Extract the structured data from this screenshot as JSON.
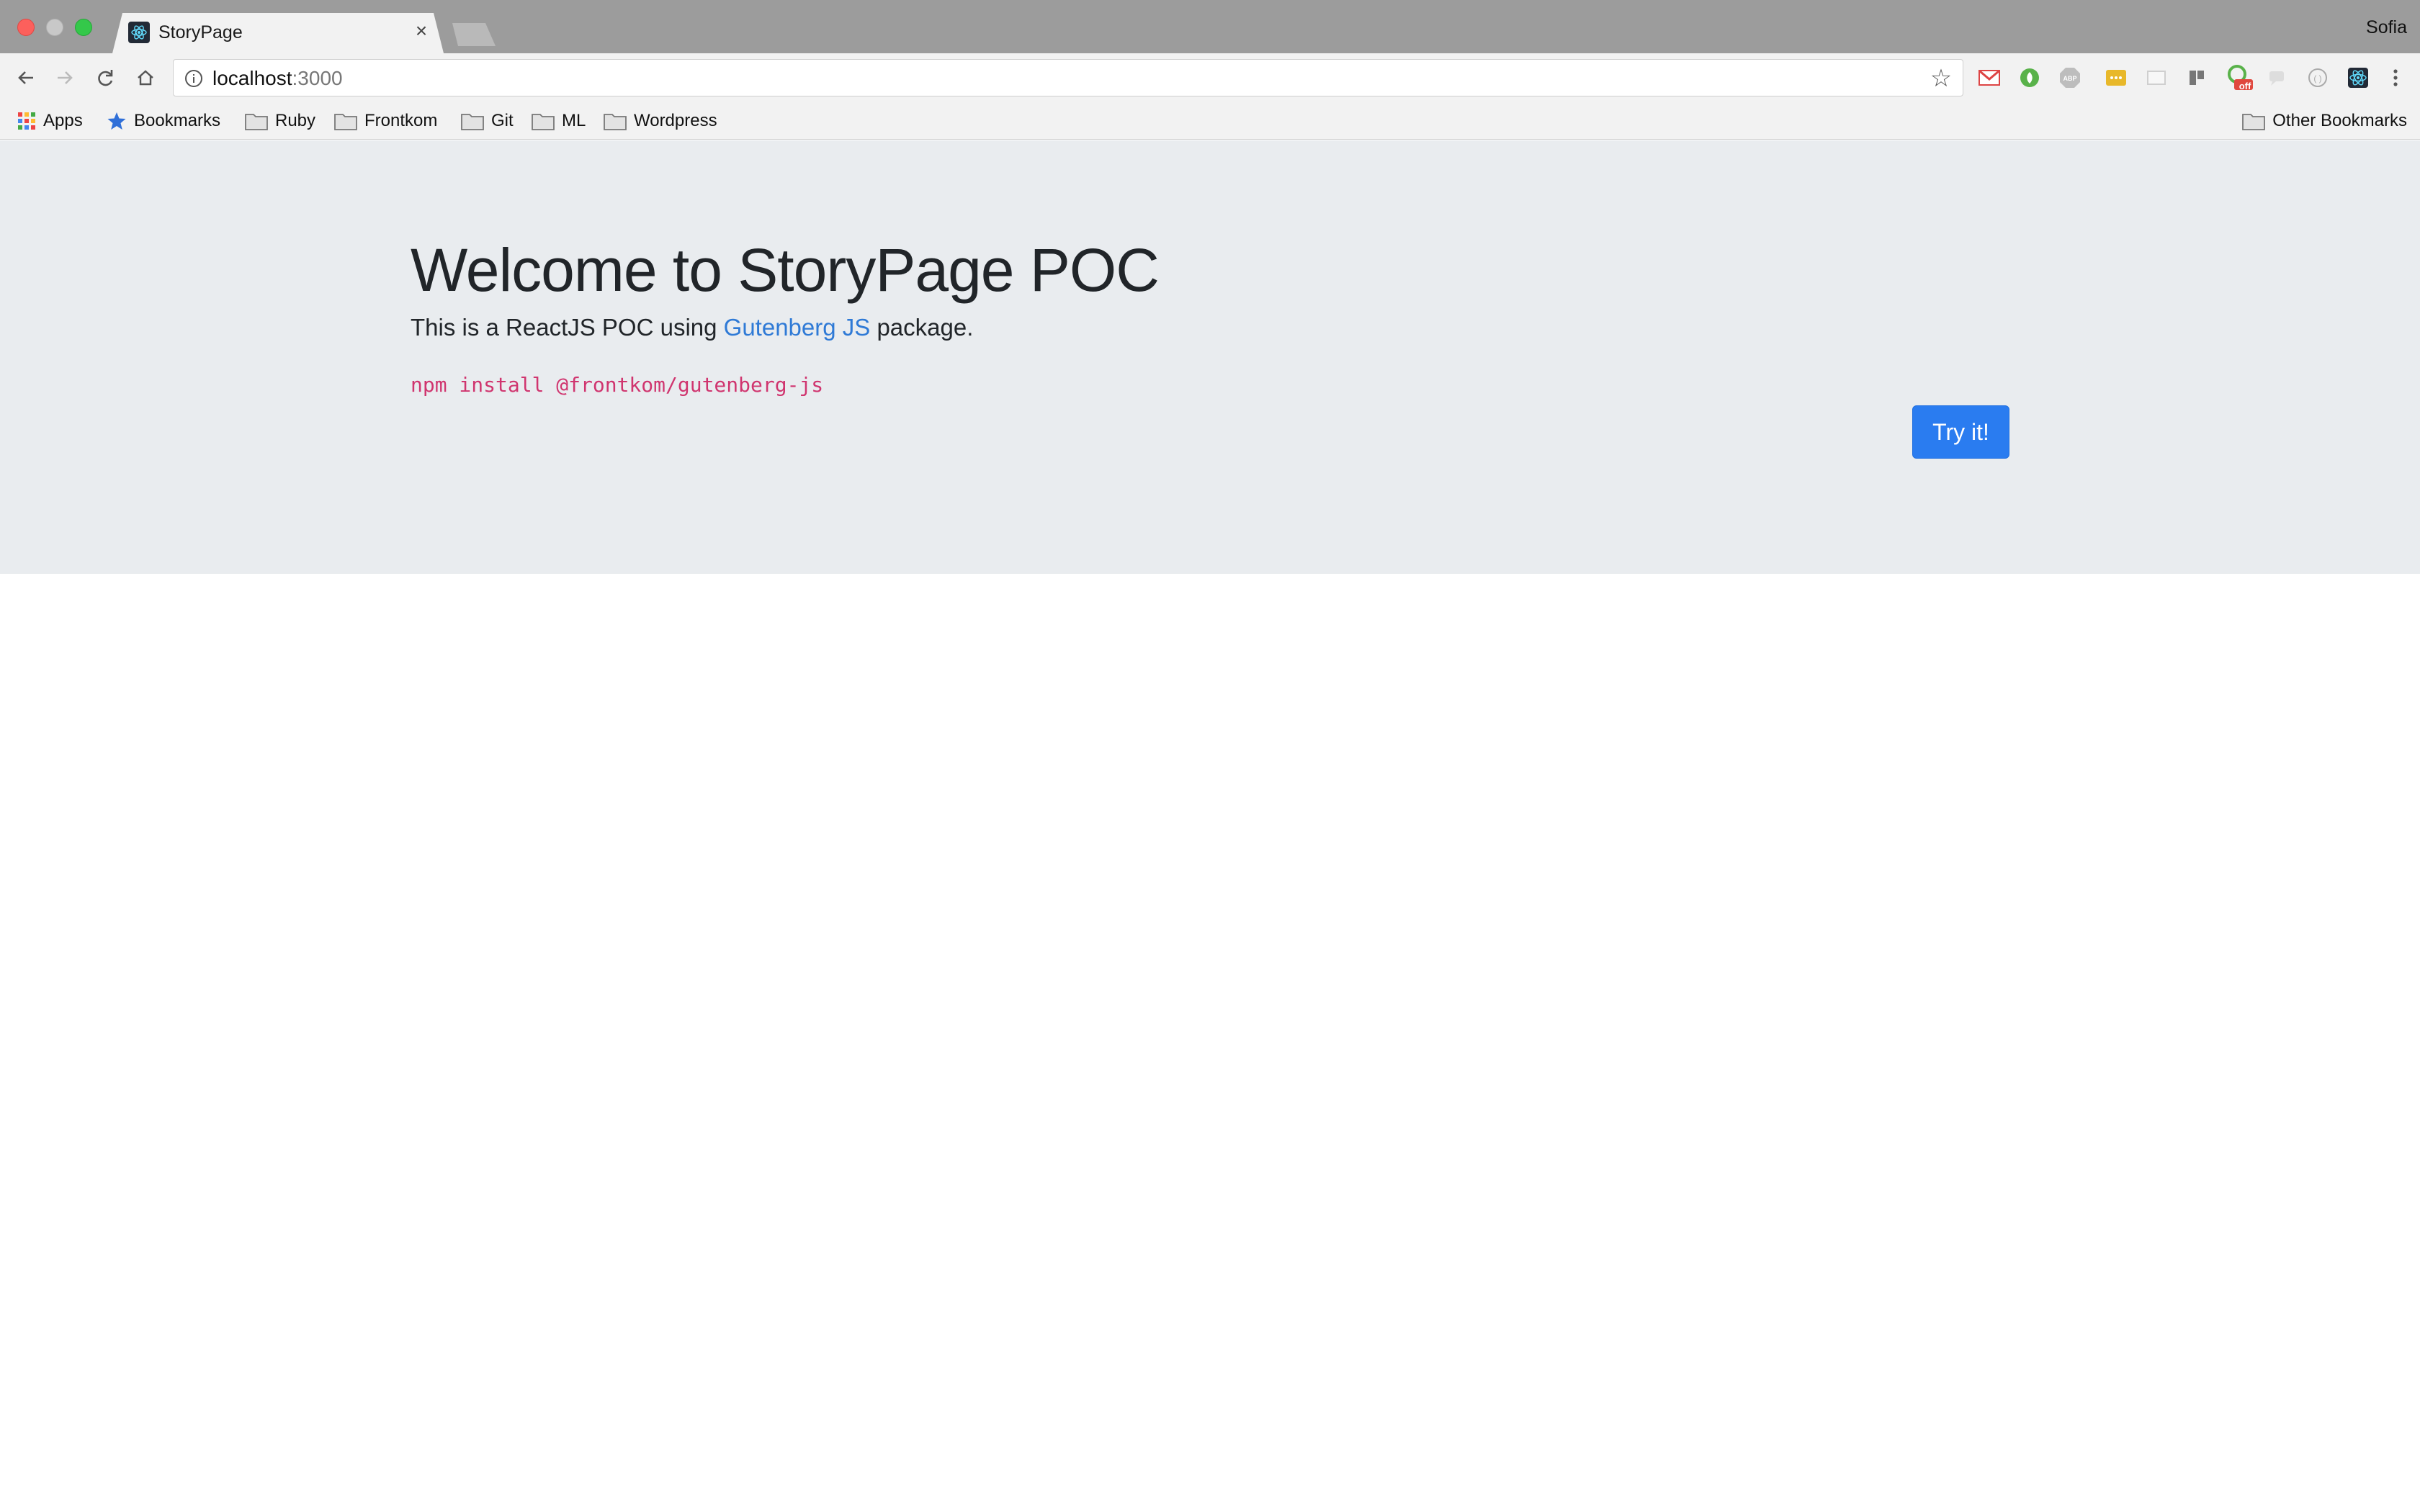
{
  "browser": {
    "tab": {
      "title": "StoryPage",
      "close_glyph": "×"
    },
    "profile_name": "Sofia",
    "url": {
      "host": "localhost",
      "port": ":3000"
    },
    "bookmarks": [
      {
        "label": "Apps",
        "icon": "apps-grid-icon"
      },
      {
        "label": "Bookmarks",
        "icon": "star-icon"
      },
      {
        "label": "Ruby",
        "icon": "folder-icon"
      },
      {
        "label": "Frontkom",
        "icon": "folder-icon"
      },
      {
        "label": "Git",
        "icon": "folder-icon"
      },
      {
        "label": "ML",
        "icon": "folder-icon"
      },
      {
        "label": "Wordpress",
        "icon": "folder-icon"
      }
    ],
    "other_bookmarks": "Other Bookmarks",
    "extension_off_badge": "off"
  },
  "page": {
    "title": "Welcome to StoryPage POC",
    "lead_prefix": "This is a ReactJS POC using ",
    "lead_link": "Gutenberg JS",
    "lead_suffix": " package.",
    "install_command": "npm install @frontkom/gutenberg-js",
    "try_button": "Try it!"
  },
  "colors": {
    "accent": "#2a7cf0",
    "link": "#2f7ad6",
    "code": "#d0356f",
    "jumbotron_bg": "#e9ecef"
  }
}
